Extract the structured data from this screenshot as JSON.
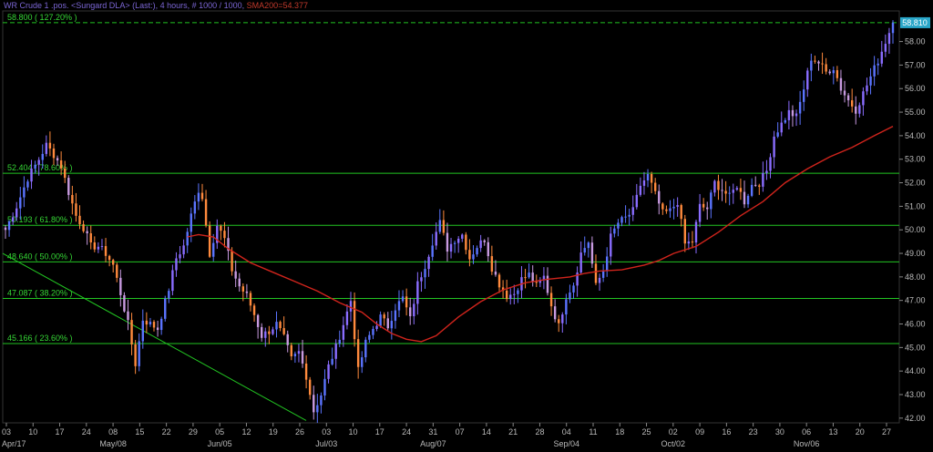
{
  "header": {
    "title": "WR Crude 1 .pos. <Sungard DLA> (Last:), 4 hours, # 1000 / 1000,",
    "indicator": "SMA200=54.377"
  },
  "price_tag": "58.810",
  "chart_data": {
    "type": "candlestick",
    "timeframe": "4 hours",
    "ylim": [
      41.8,
      59.3
    ],
    "y_ticks": [
      "58.00",
      "57.00",
      "56.00",
      "55.00",
      "54.00",
      "53.00",
      "52.00",
      "51.00",
      "50.00",
      "49.00",
      "48.00",
      "47.00",
      "46.00",
      "45.00",
      "44.00",
      "43.00",
      "42.00"
    ],
    "x_ticks": [
      "03",
      "10",
      "17",
      "24",
      "08",
      "15",
      "22",
      "29",
      "05",
      "12",
      "19",
      "26",
      "03",
      "10",
      "17",
      "24",
      "31",
      "07",
      "14",
      "21",
      "28",
      "04",
      "11",
      "18",
      "25",
      "02",
      "09",
      "16",
      "23",
      "30",
      "06",
      "13",
      "20",
      "27"
    ],
    "month_labels": [
      "Apr/17",
      "May/08",
      "Jun/05",
      "Jul/03",
      "Aug/07",
      "Sep/04",
      "Oct/02",
      "Nov/06"
    ],
    "fib_levels": [
      {
        "label": "58.800 ( 127.20% )",
        "value": 58.8,
        "style": "dashed"
      },
      {
        "label": "52.404 ( 78.60% )",
        "value": 52.404,
        "style": "solid"
      },
      {
        "label": "50.193 ( 61.80% )",
        "value": 50.193,
        "style": "solid"
      },
      {
        "label": "48.640 ( 50.00% )",
        "value": 48.64,
        "style": "solid"
      },
      {
        "label": "47.087 ( 38.20% )",
        "value": 47.087,
        "style": "solid"
      },
      {
        "label": "45.166 ( 23.60% )",
        "value": 45.166,
        "style": "solid"
      }
    ],
    "anchors": [
      [
        0,
        50.0
      ],
      [
        3,
        51.0
      ],
      [
        6,
        52.2
      ],
      [
        9,
        53.0
      ],
      [
        11,
        53.6
      ],
      [
        13,
        53.2
      ],
      [
        15,
        52.7
      ],
      [
        17,
        51.6
      ],
      [
        19,
        50.6
      ],
      [
        21,
        50.1
      ],
      [
        23,
        49.3
      ],
      [
        25,
        49.3
      ],
      [
        27,
        49.0
      ],
      [
        29,
        48.5
      ],
      [
        31,
        47.3
      ],
      [
        33,
        46.0
      ],
      [
        35,
        44.3
      ],
      [
        37,
        46.2
      ],
      [
        39,
        46.0
      ],
      [
        41,
        45.8
      ],
      [
        44,
        47.5
      ],
      [
        46,
        48.8
      ],
      [
        48,
        49.3
      ],
      [
        50,
        50.6
      ],
      [
        52,
        51.7
      ],
      [
        53,
        51.4
      ],
      [
        55,
        49.0
      ],
      [
        57,
        50.2
      ],
      [
        59,
        49.6
      ],
      [
        61,
        48.3
      ],
      [
        63,
        47.6
      ],
      [
        65,
        47.2
      ],
      [
        67,
        46.4
      ],
      [
        69,
        45.5
      ],
      [
        71,
        45.7
      ],
      [
        73,
        46.0
      ],
      [
        75,
        45.4
      ],
      [
        77,
        44.5
      ],
      [
        79,
        44.8
      ],
      [
        81,
        43.8
      ],
      [
        83,
        42.3
      ],
      [
        85,
        43.0
      ],
      [
        87,
        44.2
      ],
      [
        89,
        45.0
      ],
      [
        91,
        46.0
      ],
      [
        93,
        47.0
      ],
      [
        95,
        44.0
      ],
      [
        97,
        45.2
      ],
      [
        99,
        45.8
      ],
      [
        101,
        46.3
      ],
      [
        103,
        45.9
      ],
      [
        105,
        46.7
      ],
      [
        107,
        47.1
      ],
      [
        109,
        46.2
      ],
      [
        111,
        47.7
      ],
      [
        113,
        48.5
      ],
      [
        115,
        49.5
      ],
      [
        117,
        50.3
      ],
      [
        119,
        49.2
      ],
      [
        121,
        49.6
      ],
      [
        123,
        49.8
      ],
      [
        125,
        48.8
      ],
      [
        127,
        49.3
      ],
      [
        129,
        49.6
      ],
      [
        131,
        48.4
      ],
      [
        133,
        47.7
      ],
      [
        135,
        47.2
      ],
      [
        137,
        47.3
      ],
      [
        139,
        47.9
      ],
      [
        141,
        48.1
      ],
      [
        143,
        47.6
      ],
      [
        145,
        48.0
      ],
      [
        147,
        46.8
      ],
      [
        149,
        45.9
      ],
      [
        151,
        47.2
      ],
      [
        153,
        47.7
      ],
      [
        155,
        49.0
      ],
      [
        157,
        49.5
      ],
      [
        159,
        47.6
      ],
      [
        161,
        48.3
      ],
      [
        163,
        49.7
      ],
      [
        165,
        50.3
      ],
      [
        167,
        50.5
      ],
      [
        169,
        50.8
      ],
      [
        171,
        51.9
      ],
      [
        173,
        52.3
      ],
      [
        175,
        51.5
      ],
      [
        177,
        50.7
      ],
      [
        179,
        50.8
      ],
      [
        181,
        51.2
      ],
      [
        183,
        49.4
      ],
      [
        185,
        49.5
      ],
      [
        187,
        51.0
      ],
      [
        189,
        50.9
      ],
      [
        191,
        52.0
      ],
      [
        193,
        51.7
      ],
      [
        195,
        51.4
      ],
      [
        197,
        51.9
      ],
      [
        199,
        51.2
      ],
      [
        201,
        51.9
      ],
      [
        203,
        52.0
      ],
      [
        205,
        52.5
      ],
      [
        207,
        54.0
      ],
      [
        209,
        54.5
      ],
      [
        211,
        55.0
      ],
      [
        213,
        54.8
      ],
      [
        215,
        56.0
      ],
      [
        217,
        57.3
      ],
      [
        219,
        57.1
      ],
      [
        221,
        56.7
      ],
      [
        223,
        56.9
      ],
      [
        225,
        56.0
      ],
      [
        227,
        55.5
      ],
      [
        229,
        55.1
      ],
      [
        231,
        55.8
      ],
      [
        233,
        56.5
      ],
      [
        235,
        57.2
      ],
      [
        237,
        58.0
      ],
      [
        239,
        58.8
      ]
    ],
    "sma200_anchors": [
      [
        49,
        49.7
      ],
      [
        52,
        49.8
      ],
      [
        56,
        49.7
      ],
      [
        60,
        49.2
      ],
      [
        66,
        48.6
      ],
      [
        72,
        48.2
      ],
      [
        78,
        47.8
      ],
      [
        84,
        47.4
      ],
      [
        90,
        46.9
      ],
      [
        96,
        46.5
      ],
      [
        100,
        46.0
      ],
      [
        104,
        45.6
      ],
      [
        108,
        45.35
      ],
      [
        112,
        45.25
      ],
      [
        116,
        45.5
      ],
      [
        122,
        46.3
      ],
      [
        128,
        46.95
      ],
      [
        134,
        47.45
      ],
      [
        140,
        47.75
      ],
      [
        146,
        47.9
      ],
      [
        152,
        48.0
      ],
      [
        156,
        48.15
      ],
      [
        160,
        48.25
      ],
      [
        166,
        48.3
      ],
      [
        172,
        48.5
      ],
      [
        176,
        48.7
      ],
      [
        180,
        49.0
      ],
      [
        186,
        49.3
      ],
      [
        192,
        49.9
      ],
      [
        198,
        50.6
      ],
      [
        204,
        51.2
      ],
      [
        210,
        52.0
      ],
      [
        216,
        52.6
      ],
      [
        222,
        53.1
      ],
      [
        228,
        53.5
      ],
      [
        234,
        54.0
      ],
      [
        239,
        54.4
      ]
    ],
    "trendline": [
      {
        "x": 3,
        "y": 49.0
      },
      {
        "x": 336,
        "y": 41.9
      }
    ]
  }
}
